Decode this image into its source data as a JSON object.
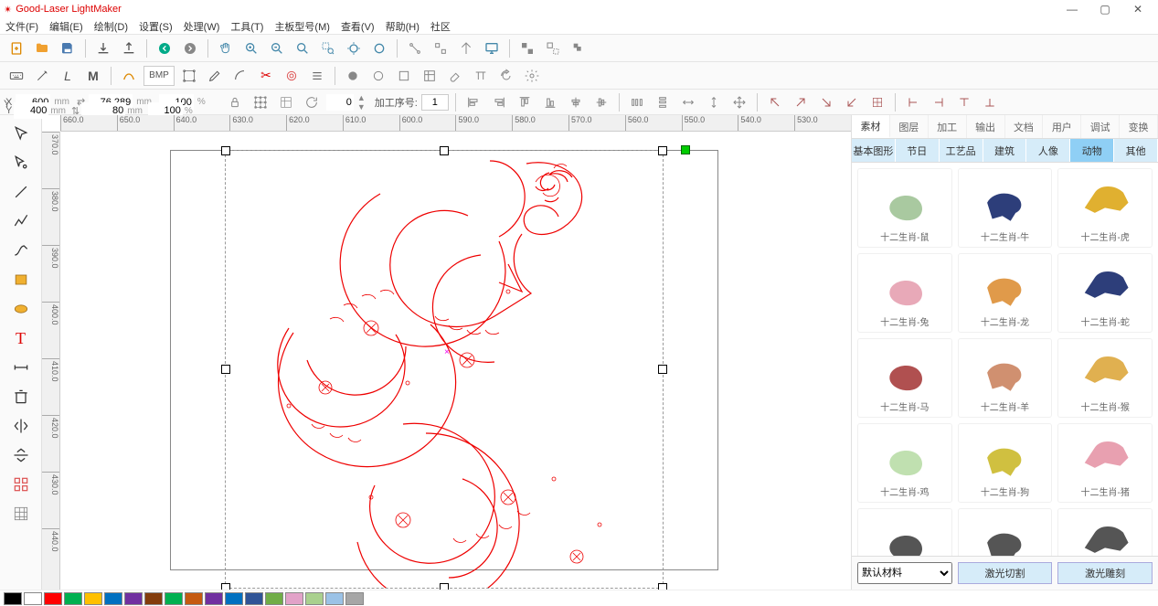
{
  "app_title": "Good-Laser LightMaker",
  "menu": [
    "文件(F)",
    "编辑(E)",
    "绘制(D)",
    "设置(S)",
    "处理(W)",
    "工具(T)",
    "主板型号(M)",
    "查看(V)",
    "帮助(H)",
    "社区"
  ],
  "coords": {
    "x_label": "X",
    "x_val": "600",
    "x_unit": "mm",
    "y_label": "Y",
    "y_val": "400",
    "y_unit": "mm",
    "w_val": "76.289",
    "w_unit": "mm",
    "h_val": "80",
    "h_unit": "mm",
    "sx_val": "100",
    "sx_unit": "%",
    "sy_val": "100",
    "sy_unit": "%",
    "rot_val": "0",
    "seq_label": "加工序号:",
    "seq_val": "1",
    "bmp": "BMP"
  },
  "ruler_h": [
    "660.0",
    "650.0",
    "640.0",
    "630.0",
    "620.0",
    "610.0",
    "600.0",
    "590.0",
    "580.0",
    "570.0",
    "560.0",
    "550.0",
    "540.0",
    "530.0"
  ],
  "ruler_v": [
    "370.0",
    "380.0",
    "390.0",
    "400.0",
    "410.0",
    "420.0",
    "430.0",
    "440.0"
  ],
  "right_tabs": [
    "素材",
    "图层",
    "加工",
    "输出",
    "文档",
    "用户",
    "调试",
    "变换"
  ],
  "sub_tabs": [
    "基本图形",
    "节日",
    "工艺品",
    "建筑",
    "人像",
    "动物",
    "其他"
  ],
  "gallery": [
    {
      "label": "十二生肖-鼠",
      "color": "#a9c9a0"
    },
    {
      "label": "十二生肖-牛",
      "color": "#2d3e7a"
    },
    {
      "label": "十二生肖-虎",
      "color": "#e0b030"
    },
    {
      "label": "十二生肖-兔",
      "color": "#e8a9b8"
    },
    {
      "label": "十二生肖-龙",
      "color": "#e09a4a"
    },
    {
      "label": "十二生肖-蛇",
      "color": "#2d3e7a"
    },
    {
      "label": "十二生肖-马",
      "color": "#b05050"
    },
    {
      "label": "十二生肖-羊",
      "color": "#d09070"
    },
    {
      "label": "十二生肖-猴",
      "color": "#e0b050"
    },
    {
      "label": "十二生肖-鸡",
      "color": "#c0e0b0"
    },
    {
      "label": "十二生肖-狗",
      "color": "#d0c040"
    },
    {
      "label": "十二生肖-猪",
      "color": "#e8a0b0"
    },
    {
      "label": "",
      "color": "#555"
    },
    {
      "label": "",
      "color": "#555"
    },
    {
      "label": "",
      "color": "#555"
    }
  ],
  "material_default": "默认材料",
  "btn_cut": "激光切割",
  "btn_engrave": "激光雕刻",
  "colors": [
    "#000000",
    "#ffffff",
    "#ff0000",
    "#00b050",
    "#ffc000",
    "#0070c0",
    "#7030a0",
    "#833c0c",
    "#00b050",
    "#c55a11",
    "#7030a0",
    "#0070c0",
    "#305496",
    "#70ad47",
    "#e2a2c8",
    "#a9d08e",
    "#9bc2e6",
    "#a6a6a6"
  ]
}
